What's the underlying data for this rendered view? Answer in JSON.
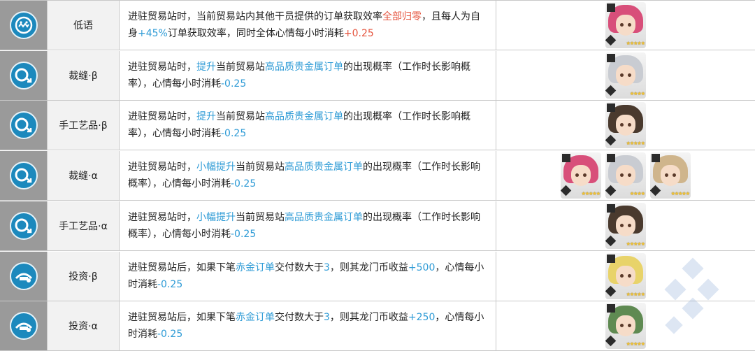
{
  "rows": [
    {
      "name": "低语",
      "icon": "whisper-skill-icon",
      "desc": [
        {
          "t": "进驻贸易站时，当前贸易站内其他干员提供的订单获取效率"
        },
        {
          "t": "全部归零",
          "c": "red"
        },
        {
          "t": "，且每人为自身"
        },
        {
          "t": "+45%",
          "c": "blue"
        },
        {
          "t": "订单获取效率，同时全体心情每小时消耗"
        },
        {
          "t": "+0.25",
          "c": "red"
        }
      ],
      "operators": [
        {
          "hair": "#d84f7a",
          "cls": "guard-class-icon",
          "stars": "★★★★★"
        }
      ]
    },
    {
      "name": "裁缝·β",
      "icon": "tailor-skill-icon",
      "desc": [
        {
          "t": "进驻贸易站时，"
        },
        {
          "t": "提升",
          "c": "blue"
        },
        {
          "t": "当前贸易站"
        },
        {
          "t": "高品质贵金属订单",
          "c": "blue"
        },
        {
          "t": "的出现概率（工作时长影响概率），心情每小时消耗"
        },
        {
          "t": "-0.25",
          "c": "blue"
        }
      ],
      "operators": [
        {
          "hair": "#c9ccd2",
          "cls": "sword-class-icon",
          "stars": "★★★★"
        }
      ]
    },
    {
      "name": "手工艺品·β",
      "icon": "tailor-skill-icon",
      "desc": [
        {
          "t": "进驻贸易站时，"
        },
        {
          "t": "提升",
          "c": "blue"
        },
        {
          "t": "当前贸易站"
        },
        {
          "t": "高品质贵金属订单",
          "c": "blue"
        },
        {
          "t": "的出现概率（工作时长影响概率），心情每小时消耗"
        },
        {
          "t": "-0.25",
          "c": "blue"
        }
      ],
      "operators": [
        {
          "hair": "#4a3a2e",
          "cls": "triangle-class-icon",
          "stars": "★★★★★"
        }
      ]
    },
    {
      "name": "裁缝·α",
      "icon": "tailor-skill-icon",
      "desc": [
        {
          "t": "进驻贸易站时，"
        },
        {
          "t": "小幅提升",
          "c": "blue"
        },
        {
          "t": "当前贸易站"
        },
        {
          "t": "高品质贵金属订单",
          "c": "blue"
        },
        {
          "t": "的出现概率（工作时长影响概率），心情每小时消耗"
        },
        {
          "t": "-0.25",
          "c": "blue"
        }
      ],
      "operators": [
        {
          "hair": "#d84f7a",
          "cls": "guard-class-icon",
          "stars": "★★★★★"
        },
        {
          "hair": "#c9ccd2",
          "cls": "sword-class-icon",
          "stars": "★★★★"
        },
        {
          "hair": "#cfb58c",
          "cls": "triangle-class-icon",
          "stars": "★★★★★"
        }
      ]
    },
    {
      "name": "手工艺品·α",
      "icon": "tailor-skill-icon",
      "desc": [
        {
          "t": "进驻贸易站时，"
        },
        {
          "t": "小幅提升",
          "c": "blue"
        },
        {
          "t": "当前贸易站"
        },
        {
          "t": "高品质贵金属订单",
          "c": "blue"
        },
        {
          "t": "的出现概率（工作时长影响概率），心情每小时消耗"
        },
        {
          "t": "-0.25",
          "c": "blue"
        }
      ],
      "operators": [
        {
          "hair": "#4a3a2e",
          "cls": "triangle-class-icon",
          "stars": "★★★★★"
        }
      ]
    },
    {
      "name": "投资·β",
      "icon": "investment-skill-icon",
      "desc": [
        {
          "t": "进驻贸易站后，如果下笔"
        },
        {
          "t": "赤金订单",
          "c": "blue"
        },
        {
          "t": "交付数大于"
        },
        {
          "t": "3",
          "c": "blue"
        },
        {
          "t": "，则其龙门币收益"
        },
        {
          "t": "+500",
          "c": "blue"
        },
        {
          "t": "，心情每小时消耗"
        },
        {
          "t": "-0.25",
          "c": "blue"
        }
      ],
      "operators": [
        {
          "hair": "#e8d36a",
          "cls": "sword-class-icon",
          "stars": "★★★★★"
        }
      ]
    },
    {
      "name": "投资·α",
      "icon": "investment-skill-icon",
      "desc": [
        {
          "t": "进驻贸易站后，如果下笔"
        },
        {
          "t": "赤金订单",
          "c": "blue"
        },
        {
          "t": "交付数大于"
        },
        {
          "t": "3",
          "c": "blue"
        },
        {
          "t": "，则其龙门币收益"
        },
        {
          "t": "+250",
          "c": "blue"
        },
        {
          "t": "，心情每小时消耗"
        },
        {
          "t": "-0.25",
          "c": "blue"
        }
      ],
      "operators": [
        {
          "hair": "#5f8a52",
          "cls": "sword-class-icon",
          "stars": "★★★★★"
        }
      ]
    }
  ],
  "colors": {
    "accent_blue": "#2e9bd6",
    "accent_red": "#e5533d",
    "icon_column": "#9a9a9a",
    "skill_icon": "#1c89bd"
  }
}
